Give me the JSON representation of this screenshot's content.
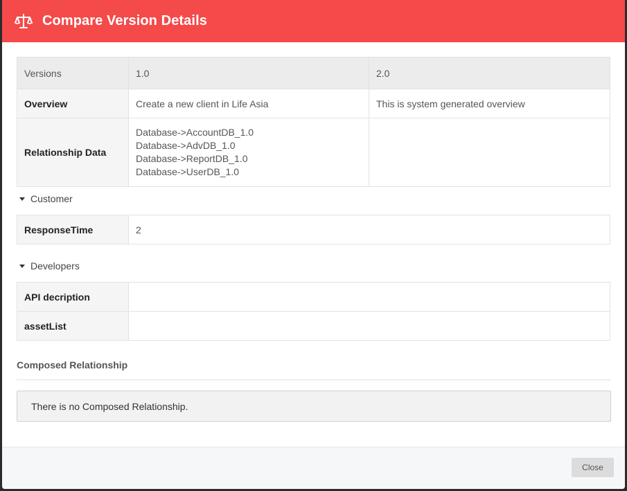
{
  "modal": {
    "title": "Compare Version Details",
    "icon": "balance-scale-icon",
    "accent": "#f44a4a"
  },
  "versions_table": {
    "header": {
      "label": "Versions",
      "v1": "1.0",
      "v2": "2.0"
    },
    "overview": {
      "label": "Overview",
      "v1": "Create a new client in Life Asia",
      "v2": "This is system generated overview"
    },
    "relationship": {
      "label": "Relationship Data",
      "v1": [
        "Database->AccountDB_1.0",
        "Database->AdvDB_1.0",
        "Database->ReportDB_1.0",
        "Database->UserDB_1.0"
      ],
      "v2": ""
    }
  },
  "customer": {
    "section_label": "Customer",
    "rows": [
      {
        "label": "ResponseTime",
        "value": "2"
      }
    ]
  },
  "developers": {
    "section_label": "Developers",
    "rows": [
      {
        "label": "API decription",
        "value": ""
      },
      {
        "label": "assetList",
        "value": ""
      }
    ]
  },
  "composed": {
    "title": "Composed Relationship",
    "empty_message": "There is no Composed Relationship."
  },
  "footer": {
    "close_label": "Close"
  }
}
